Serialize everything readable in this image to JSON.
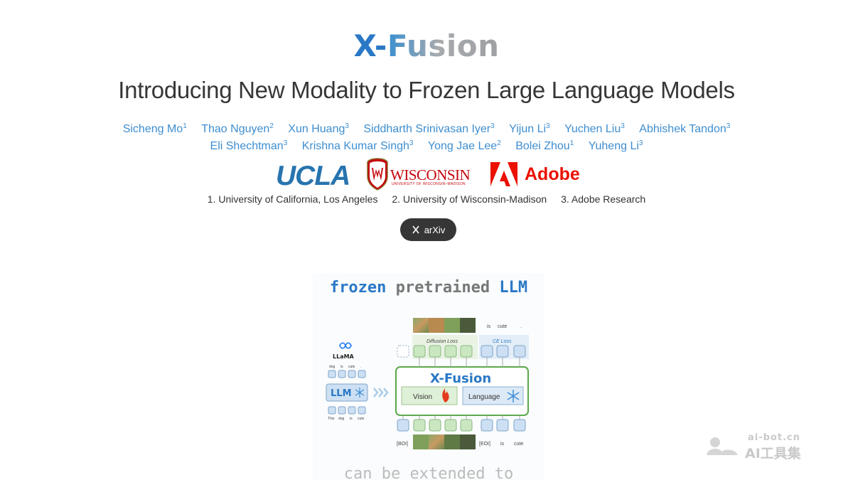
{
  "project": {
    "title_x": "X-",
    "title_fusion": "Fusion",
    "subtitle": "Introducing New Modality to Frozen Large Language Models"
  },
  "authors_row1": [
    {
      "name": "Sicheng Mo",
      "aff": "1"
    },
    {
      "name": "Thao Nguyen",
      "aff": "2"
    },
    {
      "name": "Xun Huang",
      "aff": "3"
    },
    {
      "name": "Siddharth Srinivasan Iyer",
      "aff": "3"
    },
    {
      "name": "Yijun Li",
      "aff": "3"
    },
    {
      "name": "Yuchen Liu",
      "aff": "3"
    },
    {
      "name": "Abhishek Tandon",
      "aff": "3"
    }
  ],
  "authors_row2": [
    {
      "name": "Eli Shechtman",
      "aff": "3"
    },
    {
      "name": "Krishna Kumar Singh",
      "aff": "3"
    },
    {
      "name": "Yong Jae Lee",
      "aff": "2"
    },
    {
      "name": "Bolei Zhou",
      "aff": "1"
    },
    {
      "name": "Yuheng Li",
      "aff": "3"
    }
  ],
  "institution_logos": {
    "ucla": "UCLA",
    "wisconsin": "WISCONSIN",
    "wisconsin_sub": "UNIVERSITY OF WISCONSIN–MADISON",
    "adobe": "Adobe"
  },
  "affiliations": [
    "1. University of California, Los Angeles",
    "2. University of Wisconsin-Madison",
    "3. Adobe Research"
  ],
  "links": {
    "arxiv_label": "arXiv"
  },
  "figure": {
    "heading_frozen": "frozen",
    "heading_pretrained": "pretrained",
    "heading_llm": "LLM",
    "top_tokens_is": "is",
    "top_tokens_cute": "cute",
    "top_tokens_dot": ".",
    "diffusion_loss": "Diffusion Loss",
    "ce_loss": "CE Loss",
    "xfusion_label": "X-Fusion",
    "vision_label": "Vision",
    "language_label": "Language",
    "llama_label": "LLaMA",
    "llm_label": "LLM",
    "small_top_words": [
      "dog",
      "is",
      "cute",
      "."
    ],
    "small_bottom_words": [
      "This",
      "dog",
      "is",
      "cute"
    ],
    "bottom_boi": "[BOI]",
    "bottom_eoi": "[EOI]",
    "bottom_is": "is",
    "bottom_cute": "cute",
    "bottom_caption": "can be extended to"
  },
  "watermark": {
    "top": "ai-bot.cn",
    "bottom": "AI工具集"
  },
  "colors": {
    "author_link": "#3e8ed0",
    "ucla_blue": "#2774ae",
    "wisconsin_red": "#c5050c",
    "adobe_red": "#eb1000",
    "button_dark": "#363636",
    "frame_green": "#5aa84a"
  }
}
